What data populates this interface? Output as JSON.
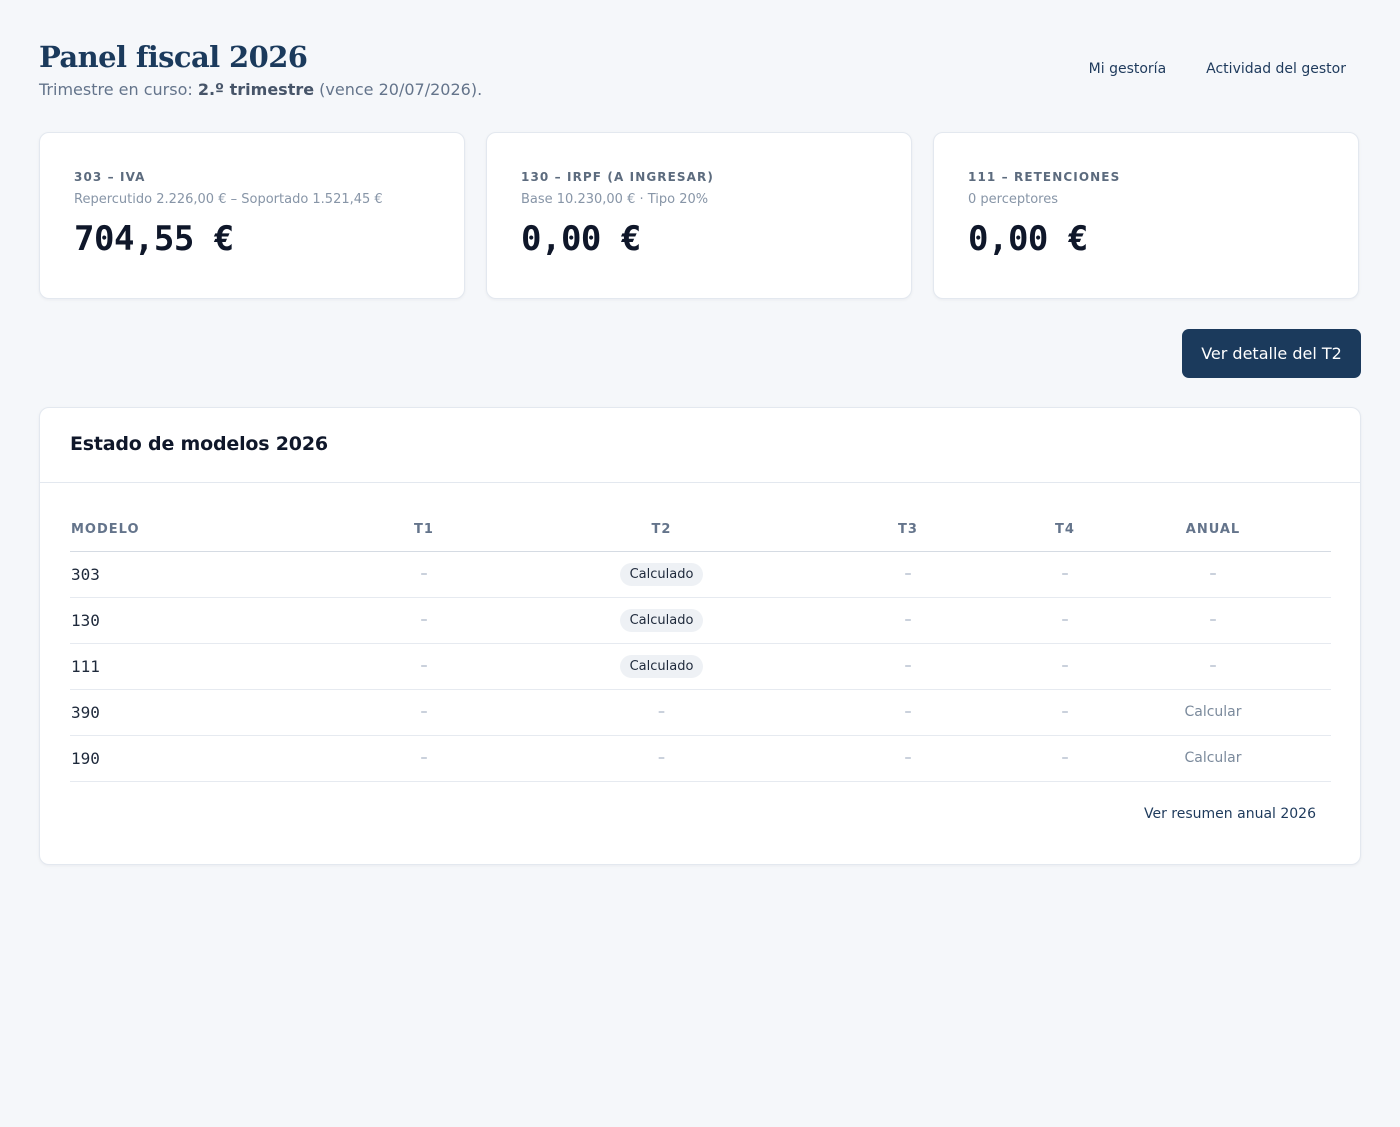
{
  "header": {
    "title": "Panel fiscal 2026",
    "subtitle_prefix": "Trimestre en curso: ",
    "subtitle_bold": "2.º trimestre",
    "subtitle_suffix": " (vence 20/07/2026)."
  },
  "nav": {
    "links": [
      "Mi gestoría",
      "Actividad del gestor"
    ]
  },
  "cards": [
    {
      "label": "303 – IVA",
      "sub": "Repercutido 2.226,00 € – Soportado 1.521,45 €",
      "value": "704,55 €"
    },
    {
      "label": "130 – IRPF (a ingresar)",
      "sub": "Base 10.230,00 € · Tipo 20%",
      "value": "0,00 €"
    },
    {
      "label": "111 – Retenciones",
      "sub": "0 perceptores",
      "value": "0,00 €"
    }
  ],
  "actions": {
    "detail_button": "Ver detalle del T2"
  },
  "panel": {
    "title": "Estado de modelos 2026",
    "columns": [
      "Modelo",
      "T1",
      "T2",
      "T3",
      "T4",
      "Anual"
    ],
    "rows": [
      {
        "model": "303",
        "t1": "–",
        "t2": "Calculado",
        "t3": "–",
        "t4": "–",
        "annual": "–"
      },
      {
        "model": "130",
        "t1": "–",
        "t2": "Calculado",
        "t3": "–",
        "t4": "–",
        "annual": "–"
      },
      {
        "model": "111",
        "t1": "–",
        "t2": "Calculado",
        "t3": "–",
        "t4": "–",
        "annual": "–"
      },
      {
        "model": "390",
        "t1": "–",
        "t2": "–",
        "t3": "–",
        "t4": "–",
        "annual": "Calcular"
      },
      {
        "model": "190",
        "t1": "–",
        "t2": "–",
        "t3": "–",
        "t4": "–",
        "annual": "Calcular"
      }
    ],
    "annual_link": "Ver resumen anual 2026"
  }
}
